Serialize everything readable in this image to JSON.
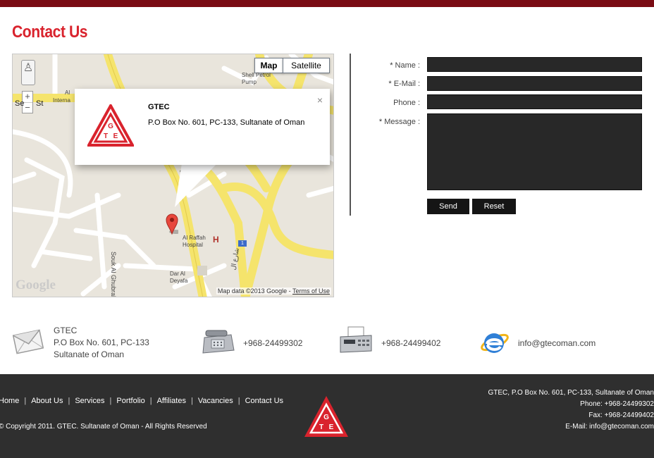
{
  "page": {
    "title": "Contact Us"
  },
  "map": {
    "type_buttons": {
      "map": "Map",
      "satellite": "Satellite"
    },
    "zoom_in": "+",
    "zoom_out": "−",
    "info_window": {
      "name": "GTEC",
      "address": "P.O Box No. 601, PC-133, Sultanate of Oman",
      "close": "×"
    },
    "labels": {
      "shell": "Shell Petrol\nPump",
      "al": "Al",
      "intl": "Interna",
      "street_se": "Se",
      "street_st": "St",
      "st_road": "St",
      "souk_al_ghubrah": "Souk Al Ghubrah St",
      "al_raffah": "Al Raffah\nHospital",
      "dar_al_deyafa": "Dar Al\nDeyafa",
      "arabic_road": "شارع ال"
    },
    "route_number": "1",
    "google_logo": "Google",
    "attribution": {
      "data": "Map data ©2013 Google",
      "separator": "-",
      "terms": "Terms of Use"
    }
  },
  "form": {
    "name_label": "Name :",
    "email_label": "E-Mail :",
    "phone_label": "Phone :",
    "message_label": "Message :",
    "required_mark": "*",
    "send": "Send",
    "reset": "Reset"
  },
  "contact": {
    "company": "GTEC",
    "address_line1": "P.O Box No. 601, PC-133",
    "address_line2": "Sultanate of Oman",
    "phone": "+968-24499302",
    "fax": "+968-24499402",
    "email": "info@gtecoman.com",
    "icons": {
      "mail": "envelope-icon",
      "phone": "telephone-icon",
      "fax": "fax-icon",
      "email": "internet-explorer-icon"
    }
  },
  "footer": {
    "nav": [
      "Home",
      "About Us",
      "Services",
      "Portfolio",
      "Affiliates",
      "Vacancies",
      "Contact Us"
    ],
    "separator": "|",
    "copyright": "© Copyright 2011. GTEC. Sultanate of Oman - All Rights Reserved",
    "right": {
      "address": "GTEC, P.O Box No. 601, PC-133, Sultanate of Oman",
      "phone": "Phone: +968-24499302",
      "fax": "Fax: +968-24499402",
      "email": "E-Mail: info@gtecoman.com"
    }
  },
  "colors": {
    "accent": "#d9232d",
    "topbar": "#7a0c14",
    "footer": "#2f2f2f",
    "field": "#282828"
  }
}
